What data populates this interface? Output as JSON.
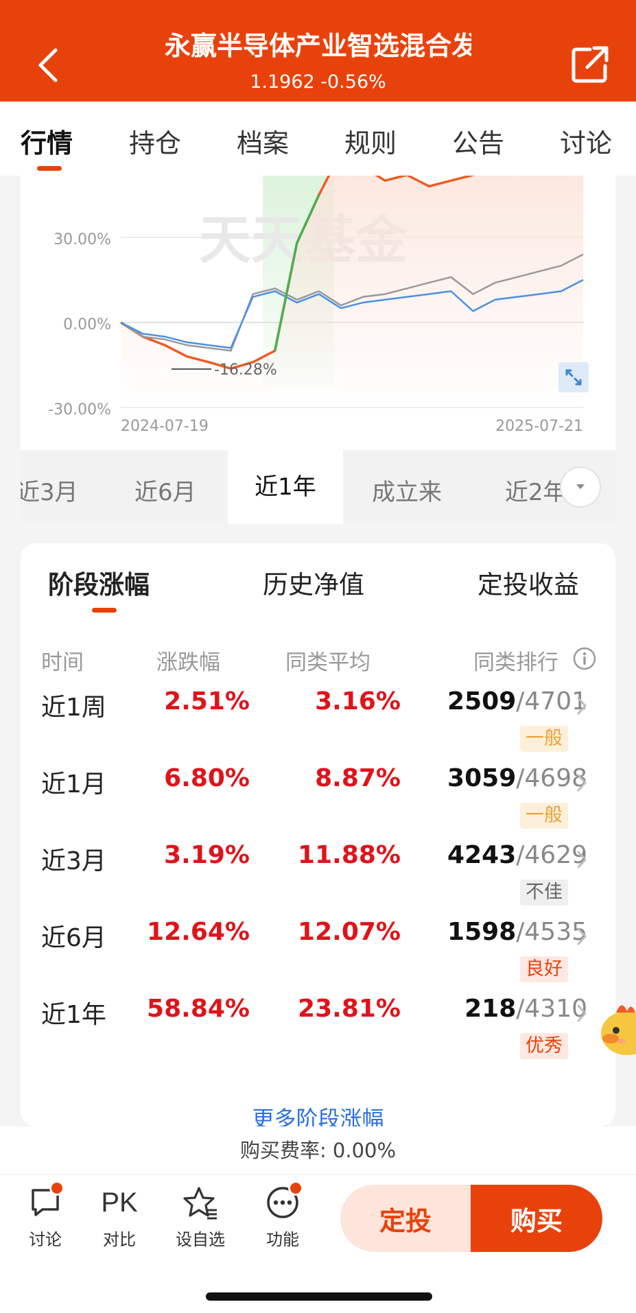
{
  "header": {
    "title": "永赢半导体产业智选混合发起",
    "subtitle": "1.1962 -0.56%",
    "bg_color": "#e8420c"
  },
  "tabs": [
    "行情",
    "持仓",
    "档案",
    "规则",
    "公告",
    "讨论"
  ],
  "chart": {
    "watermark": "天天基金",
    "y_ticks": [
      "30.00%",
      "0.00%",
      "-30.00%"
    ],
    "x_start": "2024-07-19",
    "x_end": "2025-07-21",
    "min_label": "-16.28%"
  },
  "chart_data": {
    "type": "line",
    "ylim": [
      -30,
      50
    ],
    "x_range": [
      "2024-07-19",
      "2025-07-21"
    ],
    "series": [
      {
        "color": "#ee5a24",
        "values": [
          0,
          -5,
          -8,
          -12,
          -14,
          -16.28,
          -14,
          -10,
          28,
          45,
          60,
          55,
          50,
          52,
          48,
          50,
          52,
          54,
          56,
          58,
          60,
          58
        ]
      },
      {
        "color": "#999999",
        "values": [
          0,
          -5,
          -6,
          -8,
          -9,
          -10,
          10,
          12,
          8,
          11,
          6,
          9,
          10,
          12,
          14,
          16,
          10,
          14,
          16,
          18,
          20,
          24
        ]
      },
      {
        "color": "#4a90e2",
        "values": [
          0,
          -4,
          -5,
          -7,
          -8,
          -9,
          9,
          11,
          7,
          10,
          5,
          7,
          8,
          9,
          10,
          11,
          4,
          8,
          9,
          10,
          11,
          15
        ]
      }
    ]
  },
  "ranges": [
    "近3月",
    "近6月",
    "近1年",
    "成立来",
    "近2年"
  ],
  "returns": {
    "tabs": [
      "阶段涨幅",
      "历史净值",
      "定投收益"
    ],
    "headers": [
      "时间",
      "涨跌幅",
      "同类平均",
      "同类排行"
    ],
    "rows": [
      {
        "period": "近1周",
        "change": "2.51%",
        "avg": "3.16%",
        "rank": "2509",
        "total": "/4701",
        "badge": "一般",
        "level": "mid"
      },
      {
        "period": "近1月",
        "change": "6.80%",
        "avg": "8.87%",
        "rank": "3059",
        "total": "/4698",
        "badge": "一般",
        "level": "mid"
      },
      {
        "period": "近3月",
        "change": "3.19%",
        "avg": "11.88%",
        "rank": "4243",
        "total": "/4629",
        "badge": "不佳",
        "level": "bad"
      },
      {
        "period": "近6月",
        "change": "12.64%",
        "avg": "12.07%",
        "rank": "1598",
        "total": "/4535",
        "badge": "良好",
        "level": "good"
      },
      {
        "period": "近1年",
        "change": "58.84%",
        "avg": "23.81%",
        "rank": "218",
        "total": "/4310",
        "badge": "优秀",
        "level": "good"
      }
    ],
    "more": "更多阶段涨幅"
  },
  "fee": "购买费率: 0.00%",
  "toolbar": {
    "discuss": "讨论",
    "pk_icon": "PK",
    "compare": "对比",
    "favorite": "设自选",
    "functions": "功能",
    "invest": "定投",
    "buy": "购买"
  }
}
